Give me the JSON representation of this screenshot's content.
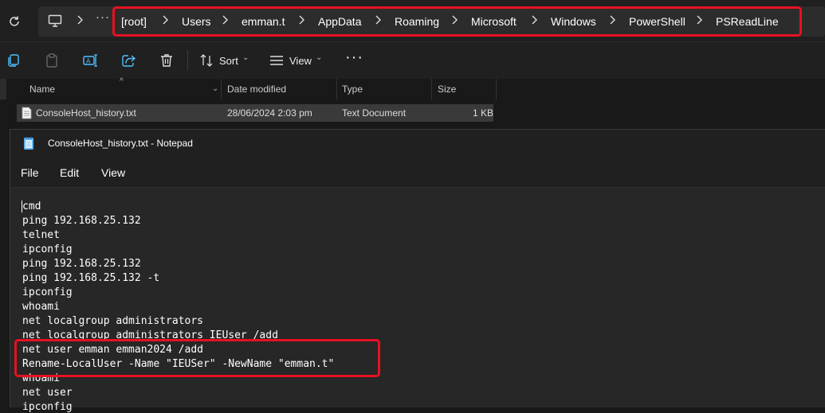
{
  "address_bar": {
    "breadcrumbs": [
      "[root]",
      "Users",
      "emman.t",
      "AppData",
      "Roaming",
      "Microsoft",
      "Windows",
      "PowerShell",
      "PSReadLine"
    ],
    "overflow_label": "···",
    "highlight_color": "#e81123"
  },
  "toolbar": {
    "sort_label": "Sort",
    "view_label": "View",
    "more_label": "···",
    "icons": [
      "copy-icon",
      "paste-icon",
      "rename-icon",
      "share-icon",
      "delete-icon",
      "sort-icon",
      "view-icon"
    ]
  },
  "file_list": {
    "columns": [
      "Name",
      "Date modified",
      "Type",
      "Size"
    ],
    "rows": [
      {
        "name": "ConsoleHost_history.txt",
        "date": "28/06/2024 2:03 pm",
        "type": "Text Document",
        "size": "1 KB"
      }
    ]
  },
  "notepad": {
    "title": "ConsoleHost_history.txt - Notepad",
    "menu": [
      "File",
      "Edit",
      "View"
    ],
    "lines": [
      "cmd",
      "ping 192.168.25.132",
      "telnet",
      "ipconfig",
      "ping 192.168.25.132",
      "ping 192.168.25.132 -t",
      "ipconfig",
      "whoami",
      "net localgroup administrators",
      "net localgroup administrators IEUser /add",
      "net user emman emman2024 /add",
      "Rename-LocalUser -Name \"IEUSer\" -NewName \"emman.t\"",
      "whoami",
      "net user",
      "ipconfig"
    ],
    "highlight_color": "#e81123"
  }
}
